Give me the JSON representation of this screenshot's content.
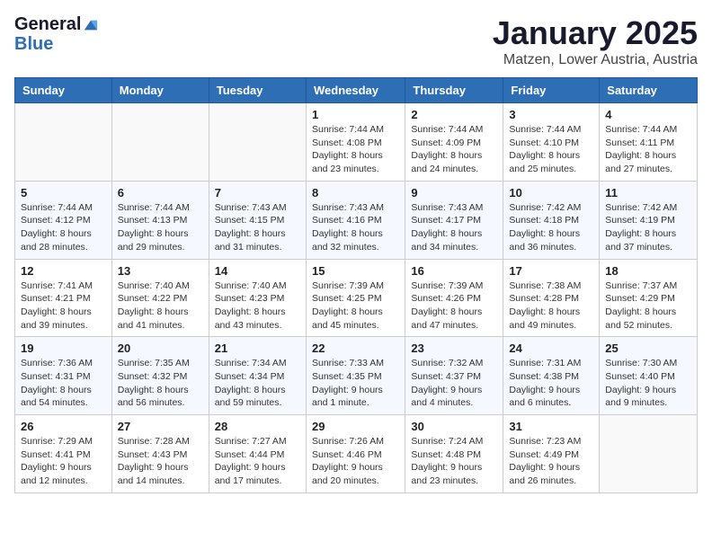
{
  "header": {
    "logo_general": "General",
    "logo_blue": "Blue",
    "month_title": "January 2025",
    "location": "Matzen, Lower Austria, Austria"
  },
  "days_of_week": [
    "Sunday",
    "Monday",
    "Tuesday",
    "Wednesday",
    "Thursday",
    "Friday",
    "Saturday"
  ],
  "weeks": [
    [
      {
        "day": "",
        "info": ""
      },
      {
        "day": "",
        "info": ""
      },
      {
        "day": "",
        "info": ""
      },
      {
        "day": "1",
        "info": "Sunrise: 7:44 AM\nSunset: 4:08 PM\nDaylight: 8 hours\nand 23 minutes."
      },
      {
        "day": "2",
        "info": "Sunrise: 7:44 AM\nSunset: 4:09 PM\nDaylight: 8 hours\nand 24 minutes."
      },
      {
        "day": "3",
        "info": "Sunrise: 7:44 AM\nSunset: 4:10 PM\nDaylight: 8 hours\nand 25 minutes."
      },
      {
        "day": "4",
        "info": "Sunrise: 7:44 AM\nSunset: 4:11 PM\nDaylight: 8 hours\nand 27 minutes."
      }
    ],
    [
      {
        "day": "5",
        "info": "Sunrise: 7:44 AM\nSunset: 4:12 PM\nDaylight: 8 hours\nand 28 minutes."
      },
      {
        "day": "6",
        "info": "Sunrise: 7:44 AM\nSunset: 4:13 PM\nDaylight: 8 hours\nand 29 minutes."
      },
      {
        "day": "7",
        "info": "Sunrise: 7:43 AM\nSunset: 4:15 PM\nDaylight: 8 hours\nand 31 minutes."
      },
      {
        "day": "8",
        "info": "Sunrise: 7:43 AM\nSunset: 4:16 PM\nDaylight: 8 hours\nand 32 minutes."
      },
      {
        "day": "9",
        "info": "Sunrise: 7:43 AM\nSunset: 4:17 PM\nDaylight: 8 hours\nand 34 minutes."
      },
      {
        "day": "10",
        "info": "Sunrise: 7:42 AM\nSunset: 4:18 PM\nDaylight: 8 hours\nand 36 minutes."
      },
      {
        "day": "11",
        "info": "Sunrise: 7:42 AM\nSunset: 4:19 PM\nDaylight: 8 hours\nand 37 minutes."
      }
    ],
    [
      {
        "day": "12",
        "info": "Sunrise: 7:41 AM\nSunset: 4:21 PM\nDaylight: 8 hours\nand 39 minutes."
      },
      {
        "day": "13",
        "info": "Sunrise: 7:40 AM\nSunset: 4:22 PM\nDaylight: 8 hours\nand 41 minutes."
      },
      {
        "day": "14",
        "info": "Sunrise: 7:40 AM\nSunset: 4:23 PM\nDaylight: 8 hours\nand 43 minutes."
      },
      {
        "day": "15",
        "info": "Sunrise: 7:39 AM\nSunset: 4:25 PM\nDaylight: 8 hours\nand 45 minutes."
      },
      {
        "day": "16",
        "info": "Sunrise: 7:39 AM\nSunset: 4:26 PM\nDaylight: 8 hours\nand 47 minutes."
      },
      {
        "day": "17",
        "info": "Sunrise: 7:38 AM\nSunset: 4:28 PM\nDaylight: 8 hours\nand 49 minutes."
      },
      {
        "day": "18",
        "info": "Sunrise: 7:37 AM\nSunset: 4:29 PM\nDaylight: 8 hours\nand 52 minutes."
      }
    ],
    [
      {
        "day": "19",
        "info": "Sunrise: 7:36 AM\nSunset: 4:31 PM\nDaylight: 8 hours\nand 54 minutes."
      },
      {
        "day": "20",
        "info": "Sunrise: 7:35 AM\nSunset: 4:32 PM\nDaylight: 8 hours\nand 56 minutes."
      },
      {
        "day": "21",
        "info": "Sunrise: 7:34 AM\nSunset: 4:34 PM\nDaylight: 8 hours\nand 59 minutes."
      },
      {
        "day": "22",
        "info": "Sunrise: 7:33 AM\nSunset: 4:35 PM\nDaylight: 9 hours\nand 1 minute."
      },
      {
        "day": "23",
        "info": "Sunrise: 7:32 AM\nSunset: 4:37 PM\nDaylight: 9 hours\nand 4 minutes."
      },
      {
        "day": "24",
        "info": "Sunrise: 7:31 AM\nSunset: 4:38 PM\nDaylight: 9 hours\nand 6 minutes."
      },
      {
        "day": "25",
        "info": "Sunrise: 7:30 AM\nSunset: 4:40 PM\nDaylight: 9 hours\nand 9 minutes."
      }
    ],
    [
      {
        "day": "26",
        "info": "Sunrise: 7:29 AM\nSunset: 4:41 PM\nDaylight: 9 hours\nand 12 minutes."
      },
      {
        "day": "27",
        "info": "Sunrise: 7:28 AM\nSunset: 4:43 PM\nDaylight: 9 hours\nand 14 minutes."
      },
      {
        "day": "28",
        "info": "Sunrise: 7:27 AM\nSunset: 4:44 PM\nDaylight: 9 hours\nand 17 minutes."
      },
      {
        "day": "29",
        "info": "Sunrise: 7:26 AM\nSunset: 4:46 PM\nDaylight: 9 hours\nand 20 minutes."
      },
      {
        "day": "30",
        "info": "Sunrise: 7:24 AM\nSunset: 4:48 PM\nDaylight: 9 hours\nand 23 minutes."
      },
      {
        "day": "31",
        "info": "Sunrise: 7:23 AM\nSunset: 4:49 PM\nDaylight: 9 hours\nand 26 minutes."
      },
      {
        "day": "",
        "info": ""
      }
    ]
  ]
}
